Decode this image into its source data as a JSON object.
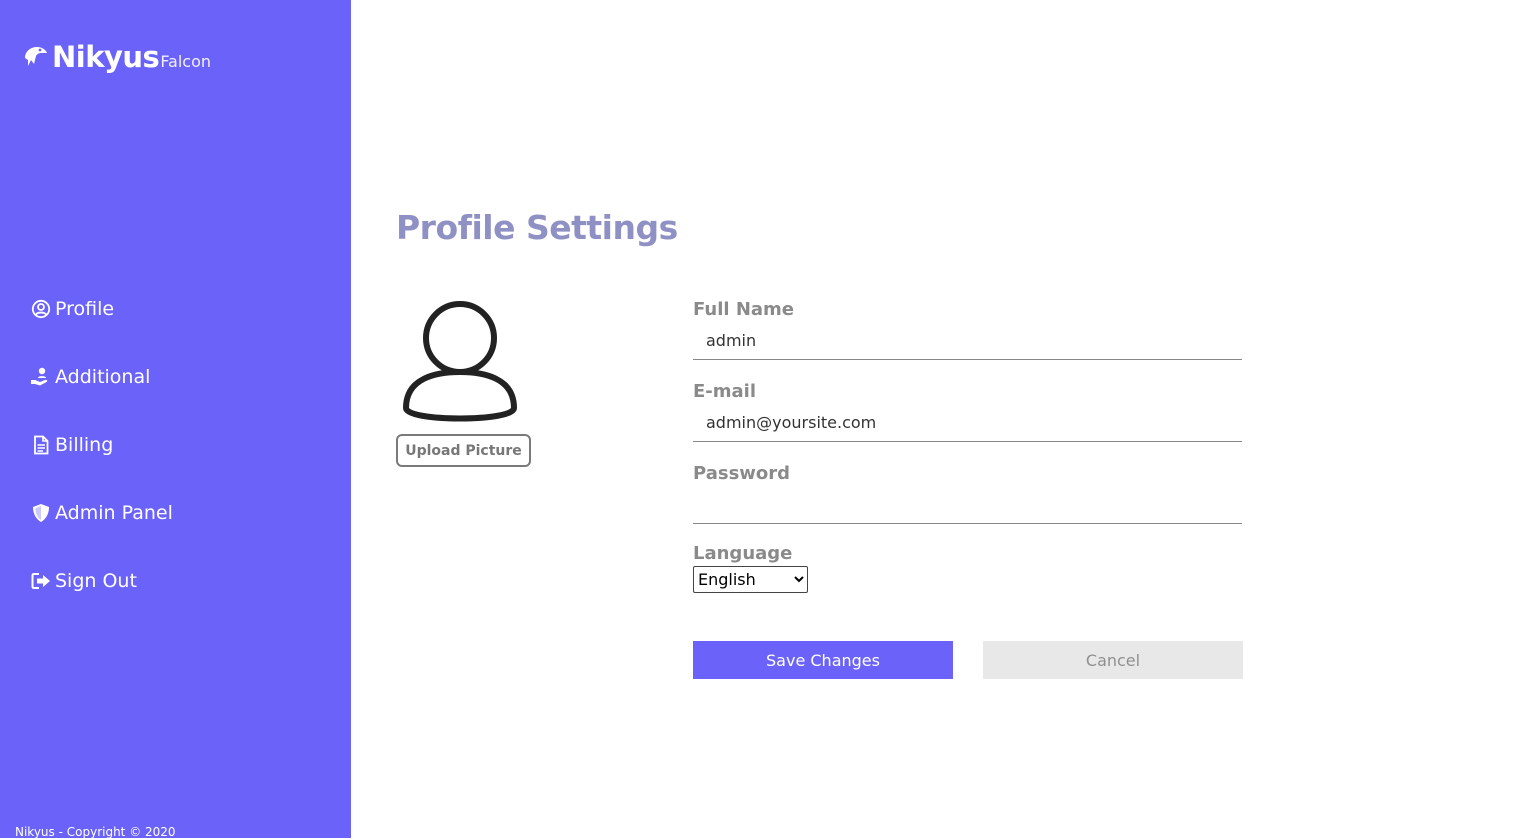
{
  "brand": {
    "name": "Nikyus",
    "sub": "Falcon",
    "icon": "falcon-icon"
  },
  "sidebar": {
    "items": [
      {
        "label": "Profile",
        "icon": "user-circle-icon"
      },
      {
        "label": "Additional",
        "icon": "hand-holding-user-icon"
      },
      {
        "label": "Billing",
        "icon": "file-text-icon"
      },
      {
        "label": "Admin Panel",
        "icon": "shield-icon"
      },
      {
        "label": "Sign Out",
        "icon": "sign-out-icon"
      }
    ],
    "copyright": "Nikyus - Copyright © 2020"
  },
  "page": {
    "title": "Profile Settings"
  },
  "avatar": {
    "icon": "user-avatar-icon",
    "upload_label": "Upload Picture"
  },
  "form": {
    "full_name": {
      "label": "Full Name",
      "value": "admin"
    },
    "email": {
      "label": "E-mail",
      "value": "admin@yoursite.com"
    },
    "password": {
      "label": "Password",
      "value": ""
    },
    "language": {
      "label": "Language",
      "selected": "English"
    }
  },
  "actions": {
    "save_label": "Save Changes",
    "cancel_label": "Cancel"
  },
  "colors": {
    "accent": "#6b63f9",
    "title": "#8f90c4",
    "label": "#8a8a8a",
    "cancel_bg": "#e8e8e8"
  }
}
